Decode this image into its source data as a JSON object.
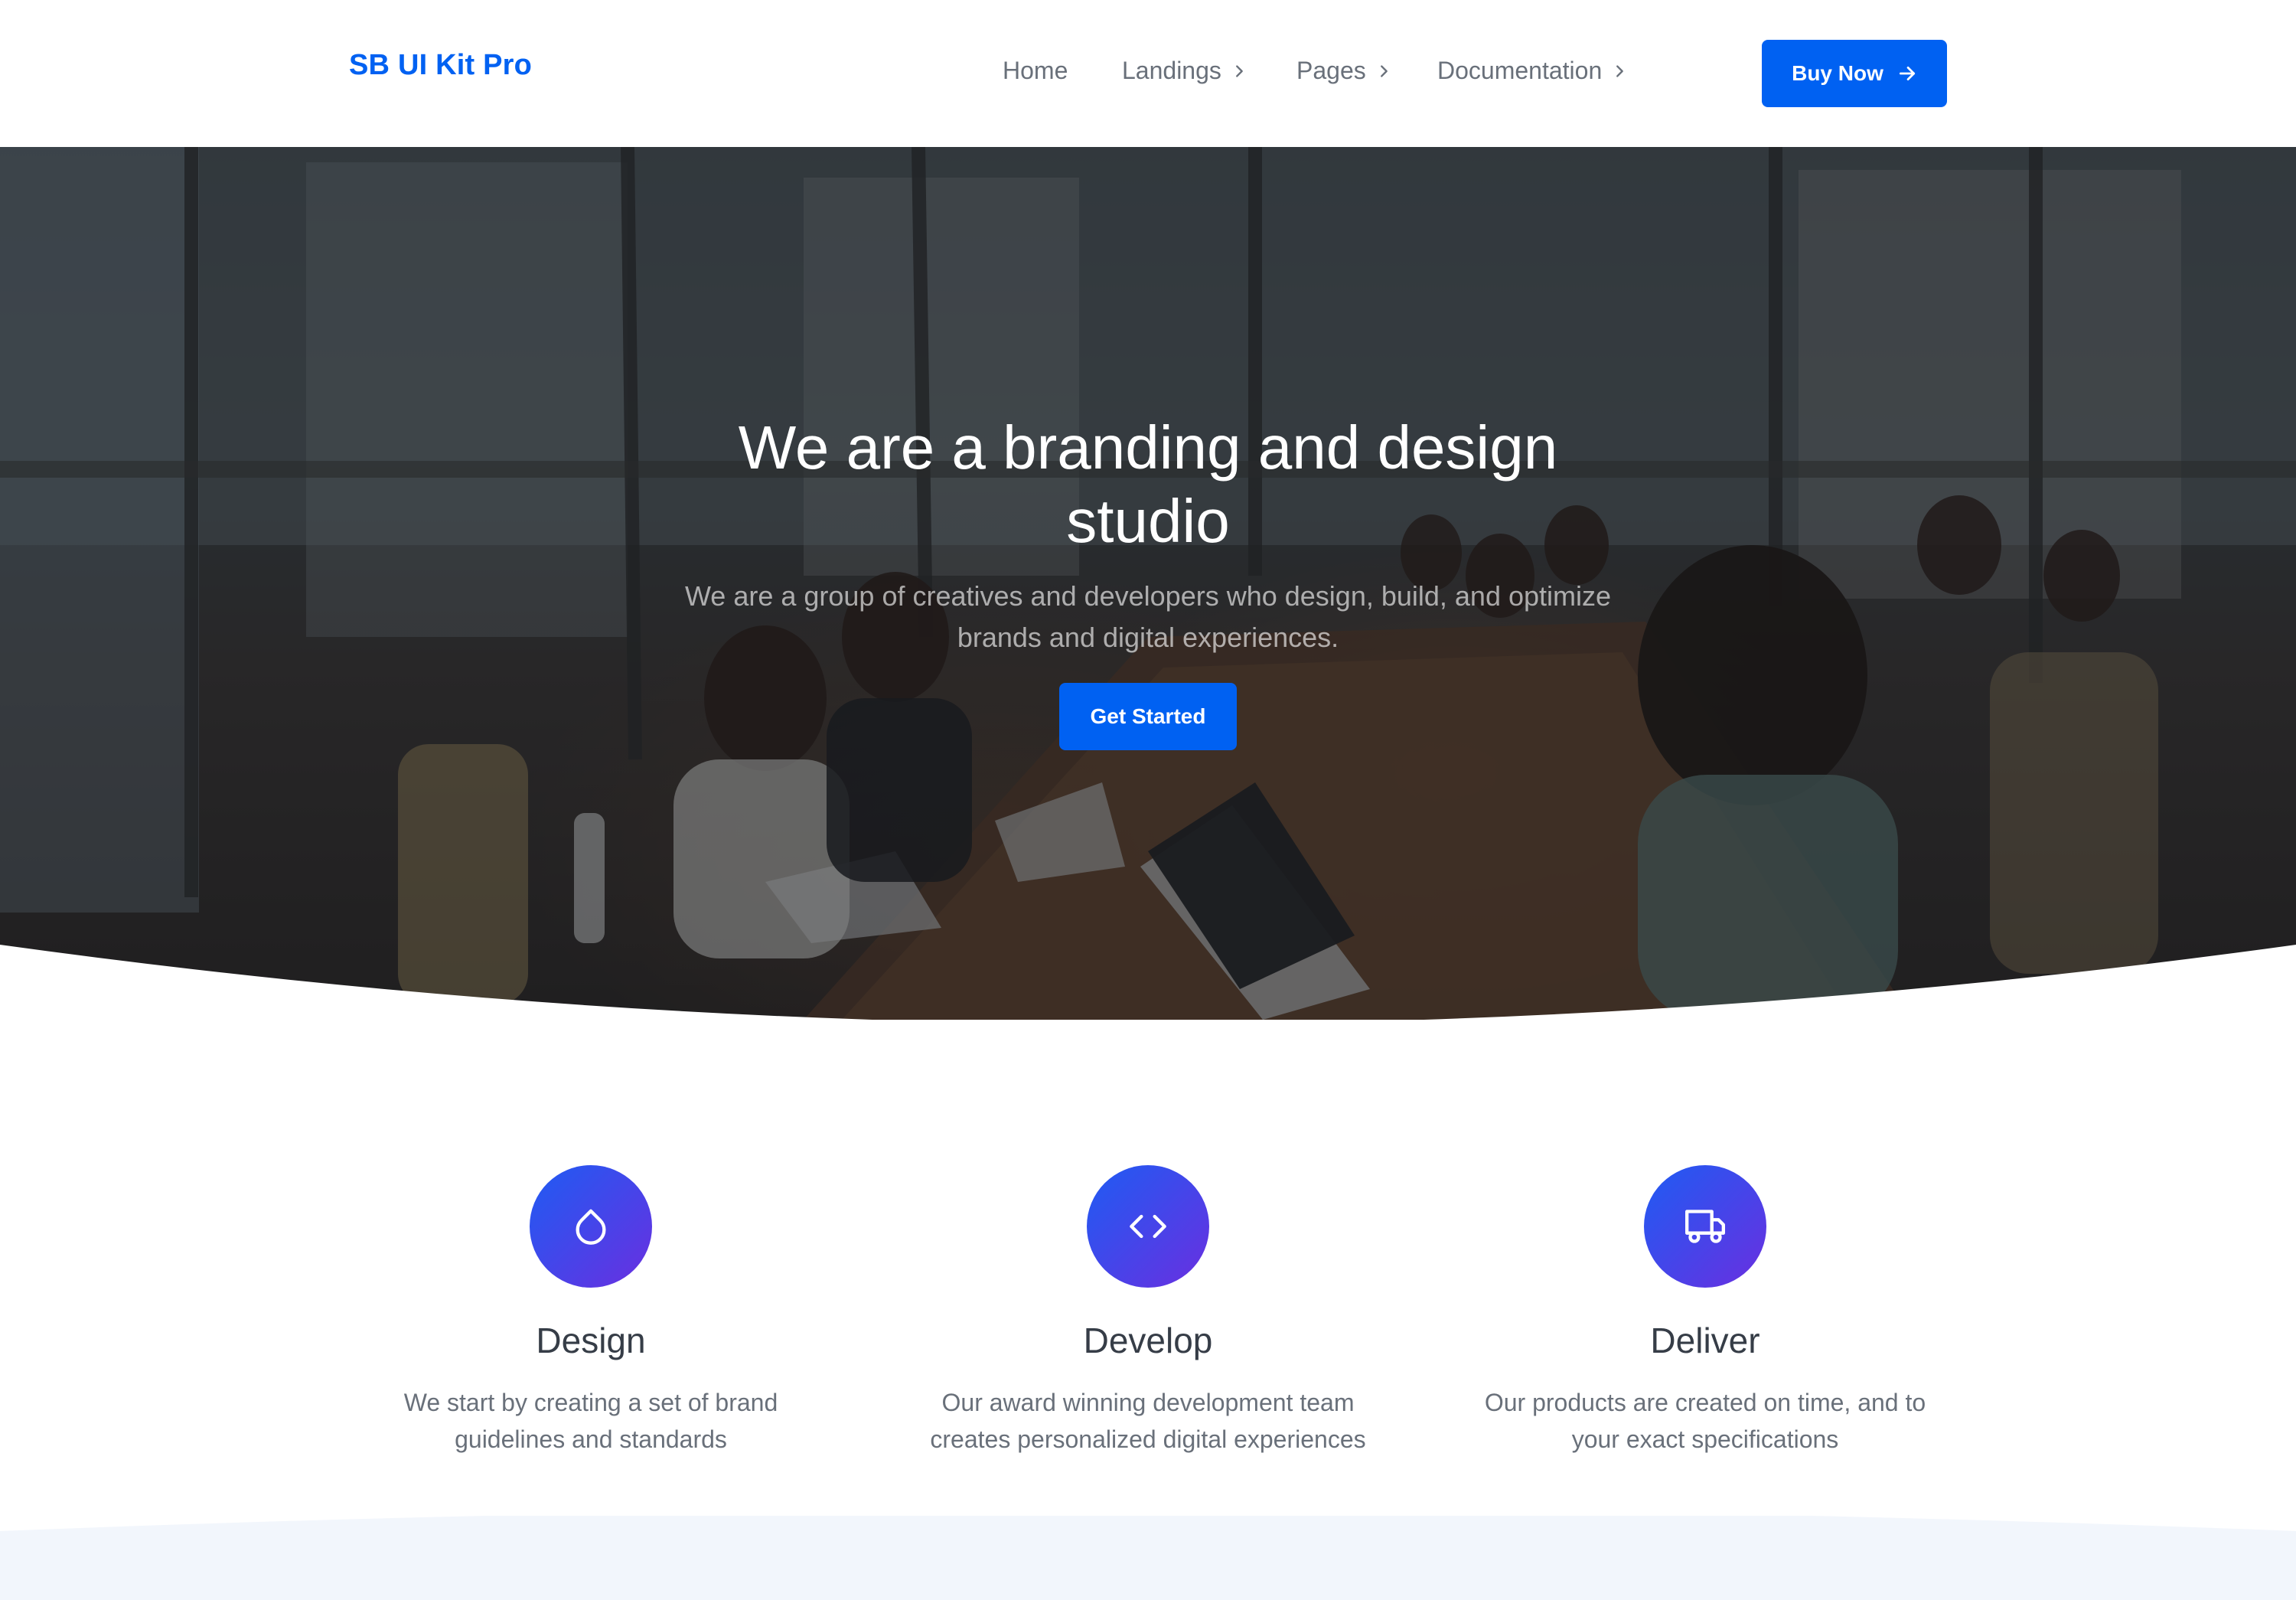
{
  "navbar": {
    "brand": "SB UI Kit Pro",
    "links": [
      {
        "label": "Home"
      },
      {
        "label": "Landings"
      },
      {
        "label": "Pages"
      },
      {
        "label": "Documentation"
      }
    ],
    "cta_label": "Buy Now",
    "icons": {
      "dropdown": "chevron-right-icon",
      "cta": "arrow-right-icon"
    }
  },
  "hero": {
    "title_line1": "We are a branding and design",
    "title_line2": "studio",
    "subtitle_line1": "We are a group of creatives and developers who design, build, and optimize",
    "subtitle_line2": "brands and digital experiences.",
    "button_label": "Get Started"
  },
  "features": [
    {
      "icon": "droplet-icon",
      "title": "Design",
      "text_line1": "We start by creating a set of brand",
      "text_line2": "guidelines and standards"
    },
    {
      "icon": "code-icon",
      "title": "Develop",
      "text_line1": "Our award winning development team",
      "text_line2": "creates personalized digital experiences"
    },
    {
      "icon": "truck-icon",
      "title": "Deliver",
      "text_line1": "Our products are created on time, and to",
      "text_line2": "your exact specifications"
    }
  ],
  "colors": {
    "primary": "#0061f2",
    "icon_gradient_start": "#1e5cf3",
    "icon_gradient_end": "#6a2fe0",
    "text_dark": "#363d47",
    "text_muted": "#69707a",
    "section_light": "#f2f6fc"
  }
}
